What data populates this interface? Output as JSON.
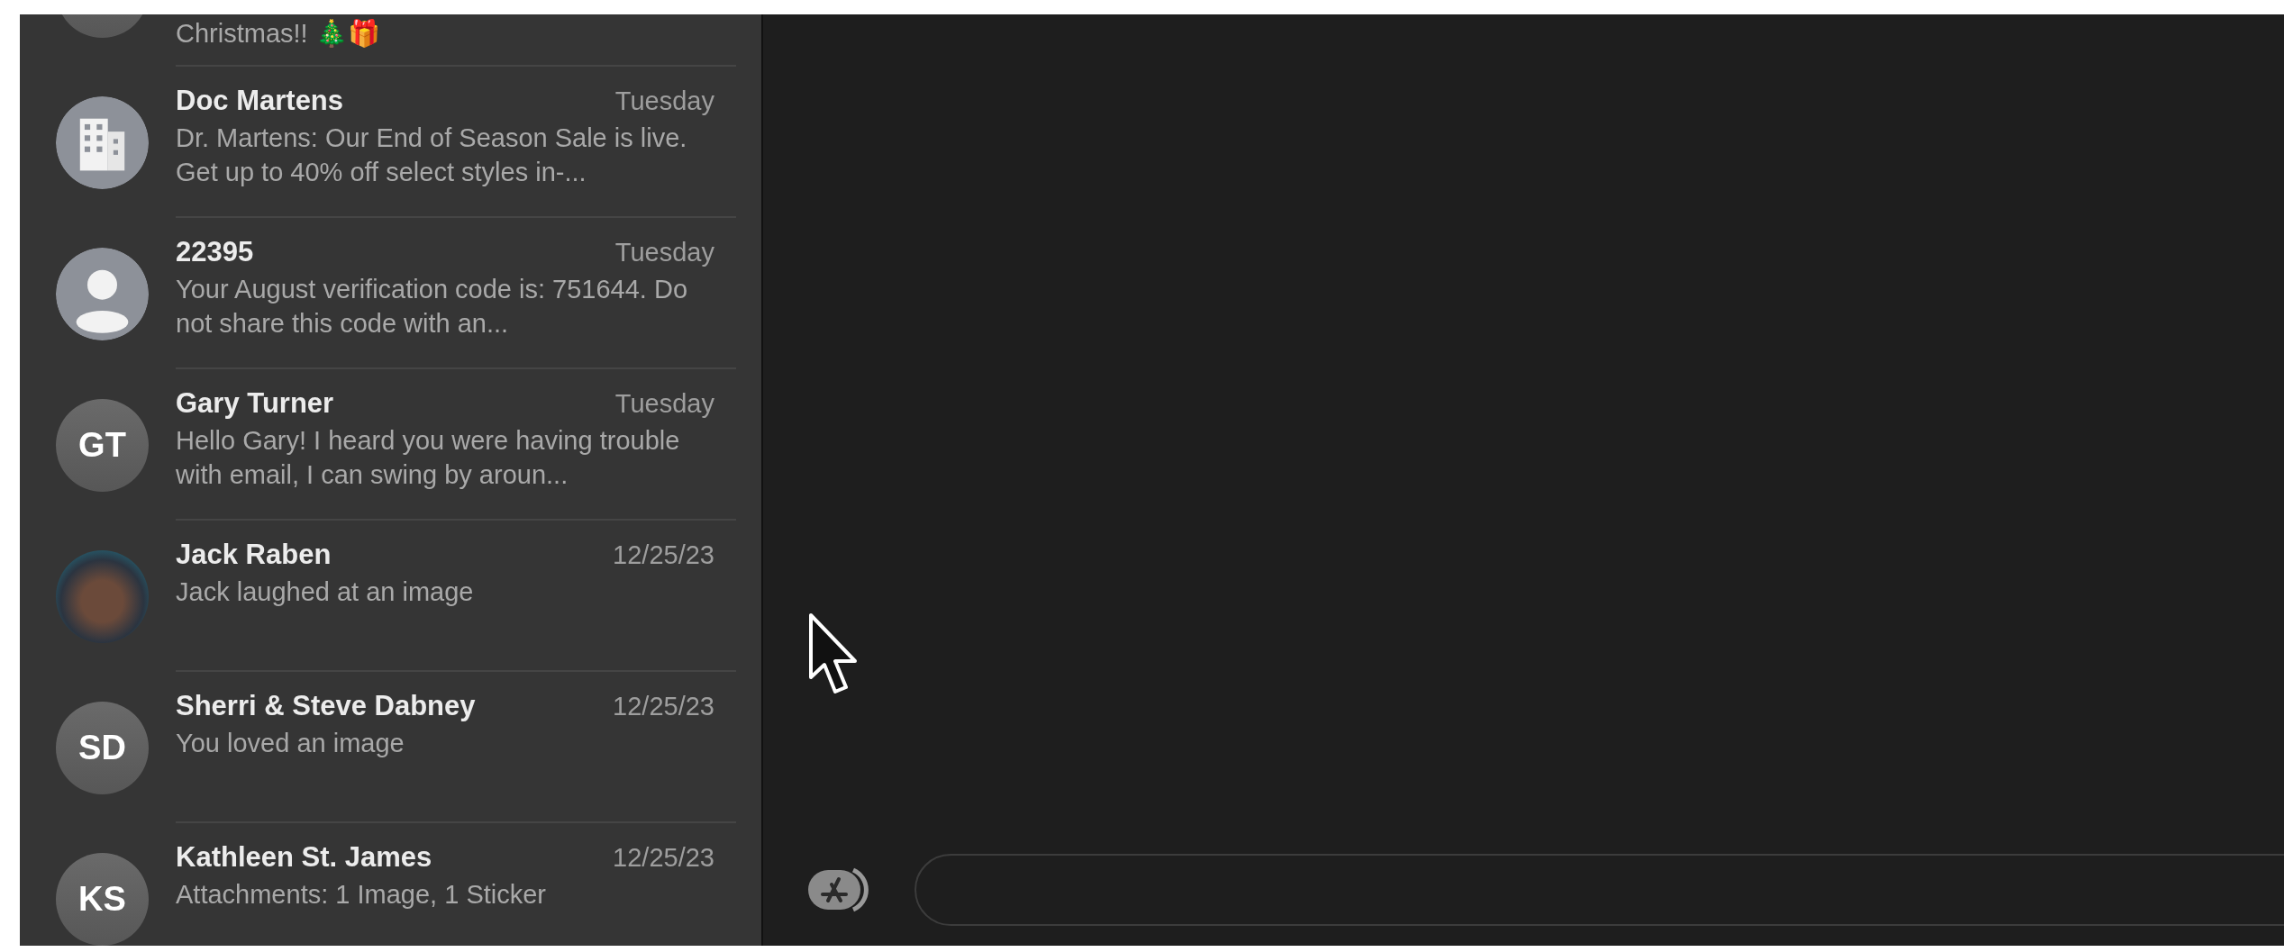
{
  "conversations": [
    {
      "avatar": {
        "kind": "plain"
      },
      "preview": "Christmas!! 🎄🎁"
    },
    {
      "avatar": {
        "kind": "building"
      },
      "name": "Doc Martens",
      "date": "Tuesday",
      "preview": "Dr. Martens: Our End of Season Sale is live. Get up to 40% off select styles in-..."
    },
    {
      "avatar": {
        "kind": "person"
      },
      "name": "22395",
      "date": "Tuesday",
      "preview": "Your August verification code is: 751644. Do not share this code with an..."
    },
    {
      "avatar": {
        "kind": "initials",
        "initials": "GT"
      },
      "name": "Gary Turner",
      "date": "Tuesday",
      "preview": "Hello Gary! I heard you were having trouble with email, I can swing by aroun..."
    },
    {
      "avatar": {
        "kind": "photo"
      },
      "name": "Jack Raben",
      "date": "12/25/23",
      "preview": "Jack laughed at an image"
    },
    {
      "avatar": {
        "kind": "initials",
        "initials": "SD"
      },
      "name": "Sherri & Steve Dabney",
      "date": "12/25/23",
      "preview": "You loved an image"
    },
    {
      "avatar": {
        "kind": "initials",
        "initials": "KS"
      },
      "name": "Kathleen St. James",
      "date": "12/25/23",
      "preview": "Attachments: 1 Image, 1 Sticker"
    }
  ]
}
